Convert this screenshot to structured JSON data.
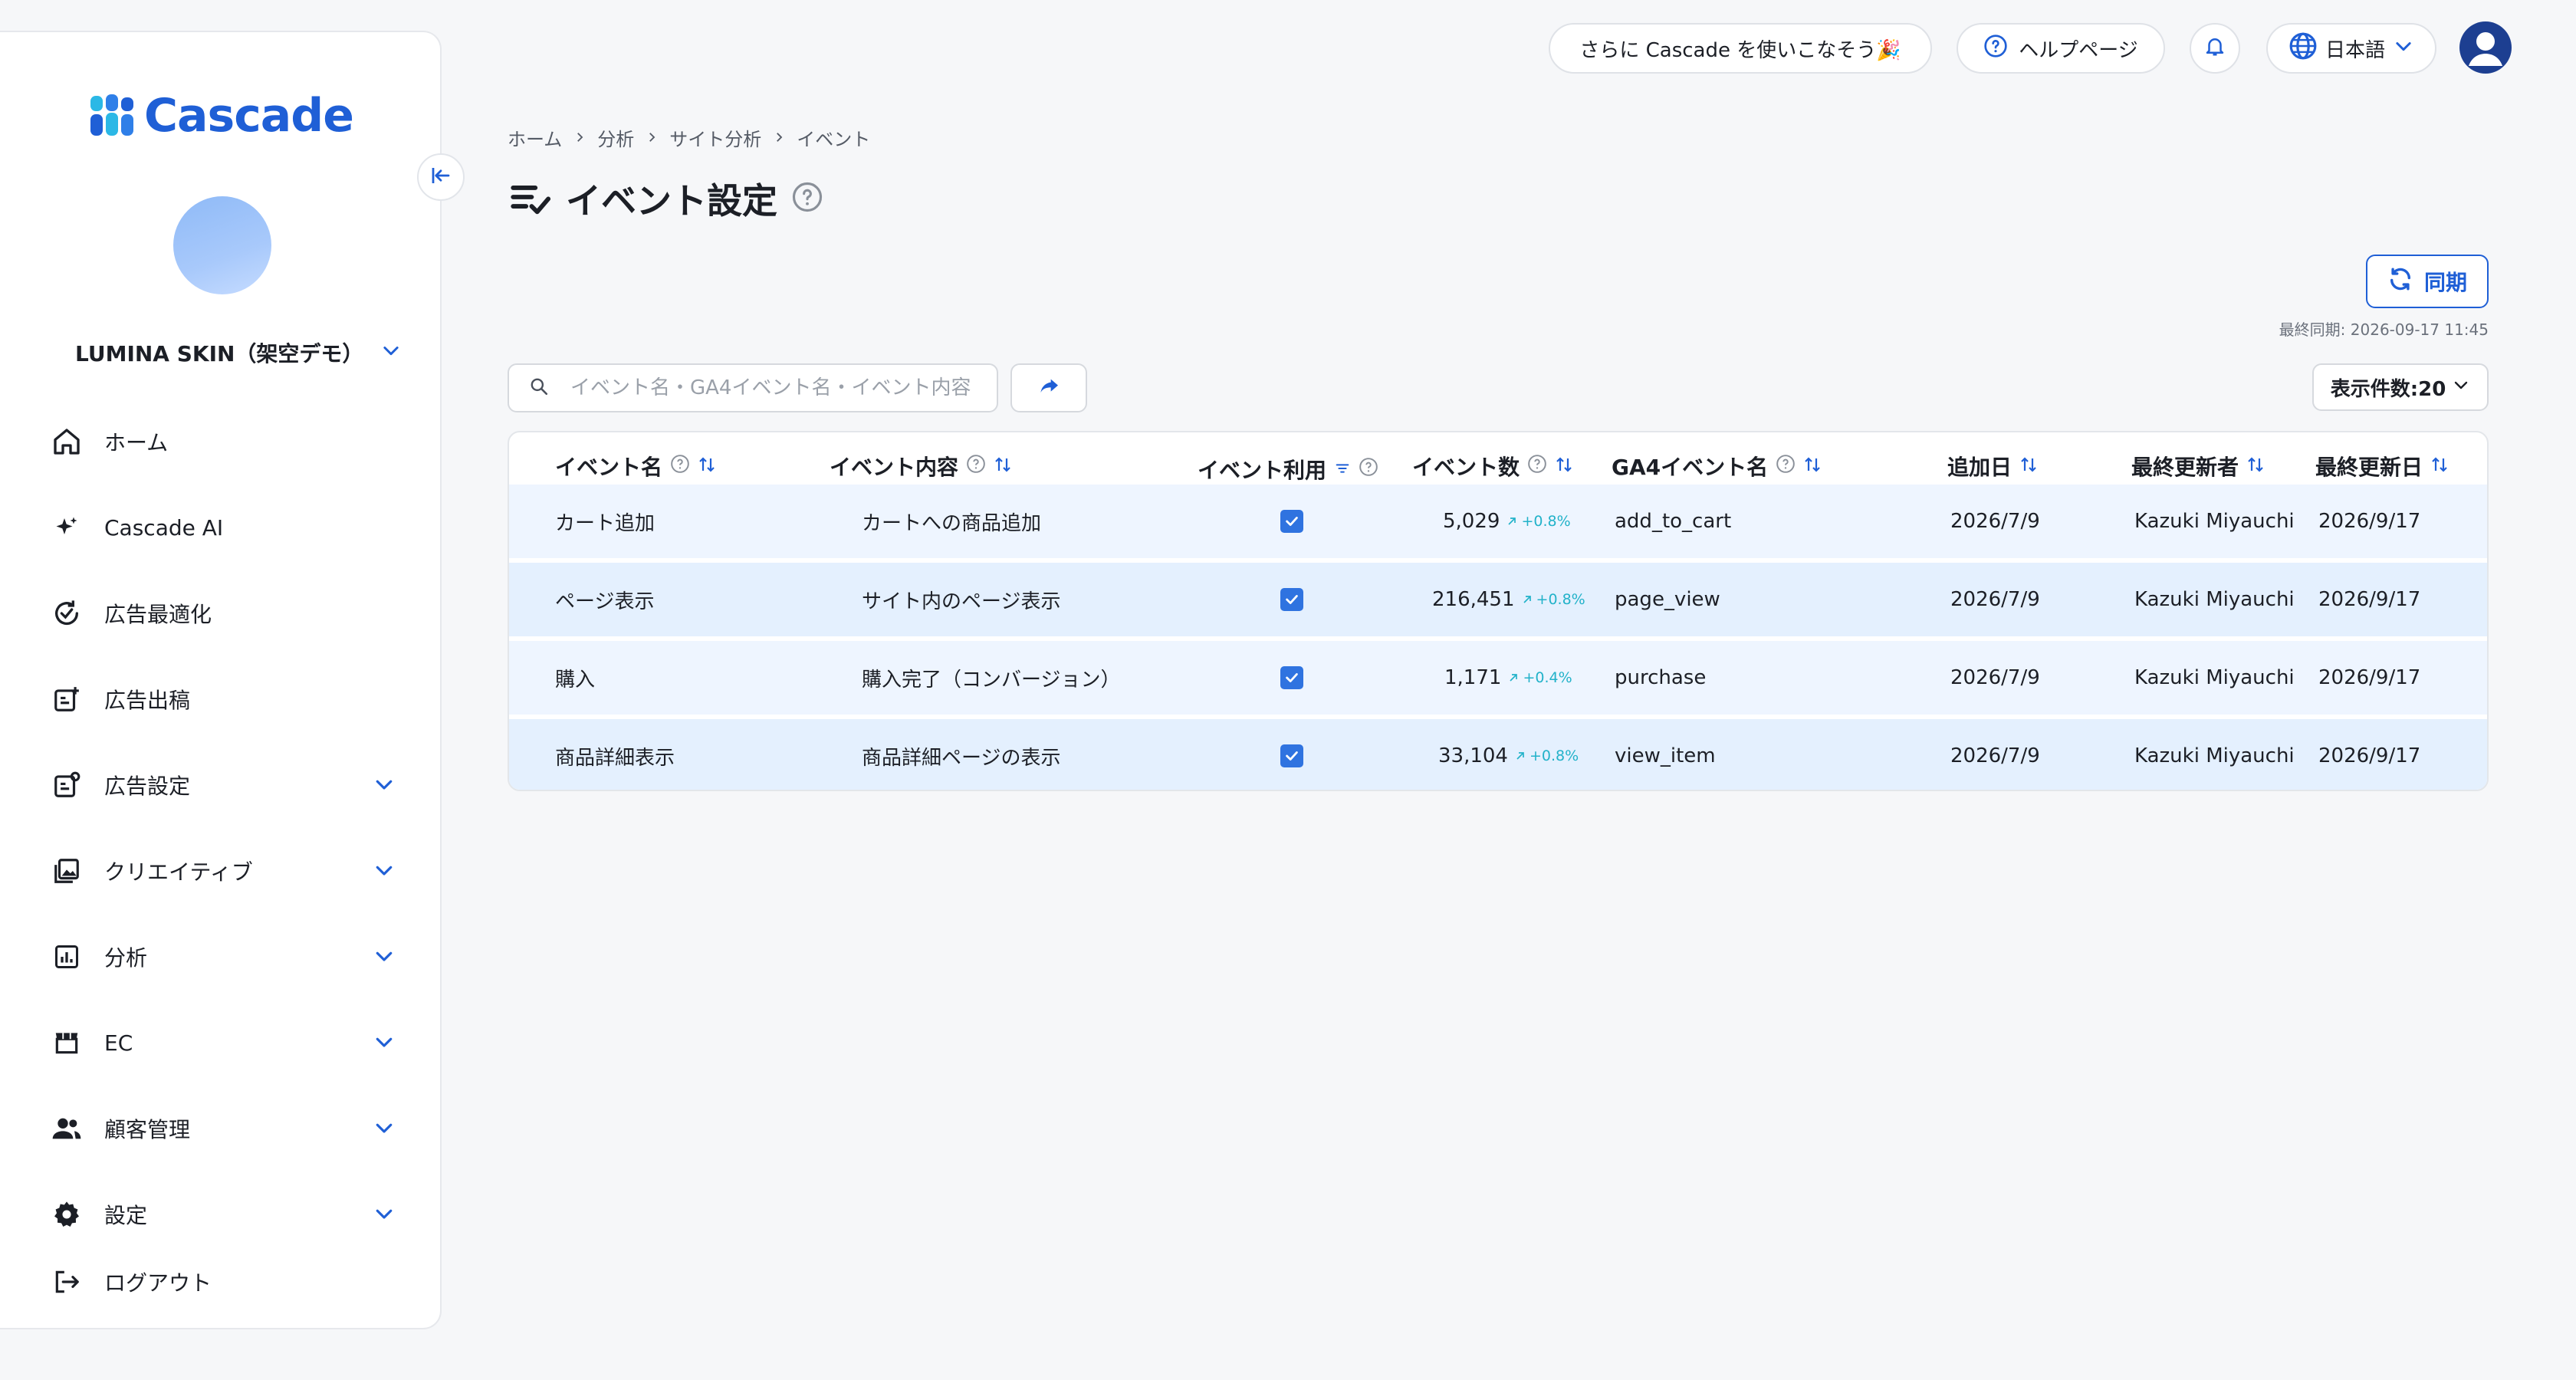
{
  "app": {
    "logo_text": "Cascade",
    "brand_color": "#1f5fd6"
  },
  "sidebar": {
    "account_name": "LUMINA SKIN（架空デモ）",
    "items": [
      {
        "label": "ホーム",
        "icon": "home-icon"
      },
      {
        "label": "Cascade AI",
        "icon": "sparkle-icon"
      },
      {
        "label": "広告最適化",
        "icon": "optimize-icon"
      },
      {
        "label": "広告出稿",
        "icon": "ad-post-icon"
      },
      {
        "label": "広告設定",
        "icon": "ad-settings-icon"
      },
      {
        "label": "クリエイティブ",
        "icon": "image-icon"
      },
      {
        "label": "分析",
        "icon": "chart-icon"
      },
      {
        "label": "EC",
        "icon": "store-icon"
      },
      {
        "label": "顧客管理",
        "icon": "users-icon"
      },
      {
        "label": "設定",
        "icon": "gear-icon"
      },
      {
        "label": "ログアウト",
        "icon": "logout-icon"
      }
    ]
  },
  "topbar": {
    "promo": "さらに Cascade を使いこなそう🎉",
    "help": "ヘルプページ",
    "language": "日本語"
  },
  "breadcrumb": [
    "ホーム",
    "分析",
    "サイト分析",
    "イベント"
  ],
  "page": {
    "title": "イベント設定",
    "sync_label": "同期",
    "last_sync": "最終同期: 2026-09-17 11:45",
    "search_placeholder": "イベント名・GA4イベント名・イベント内容",
    "page_size_label": "表示件数:20"
  },
  "table": {
    "headers": [
      "イベント名",
      "イベント内容",
      "イベント利用",
      "イベント数",
      "GA4イベント名",
      "追加日",
      "最終更新者",
      "最終更新日"
    ],
    "rows": [
      {
        "name": "カート追加",
        "desc": "カートへの商品追加",
        "enabled": true,
        "count": "5,029",
        "trend": "+0.8%",
        "ga4": "add_to_cart",
        "added": "2026/7/9",
        "updater": "Kazuki Miyauchi",
        "updated": "2026/9/17"
      },
      {
        "name": "ページ表示",
        "desc": "サイト内のページ表示",
        "enabled": true,
        "count": "216,451",
        "trend": "+0.8%",
        "ga4": "page_view",
        "added": "2026/7/9",
        "updater": "Kazuki Miyauchi",
        "updated": "2026/9/17"
      },
      {
        "name": "購入",
        "desc": "購入完了（コンバージョン）",
        "enabled": true,
        "count": "1,171",
        "trend": "+0.4%",
        "ga4": "purchase",
        "added": "2026/7/9",
        "updater": "Kazuki Miyauchi",
        "updated": "2026/9/17"
      },
      {
        "name": "商品詳細表示",
        "desc": "商品詳細ページの表示",
        "enabled": true,
        "count": "33,104",
        "trend": "+0.8%",
        "ga4": "view_item",
        "added": "2026/7/9",
        "updater": "Kazuki Miyauchi",
        "updated": "2026/9/17"
      }
    ]
  }
}
